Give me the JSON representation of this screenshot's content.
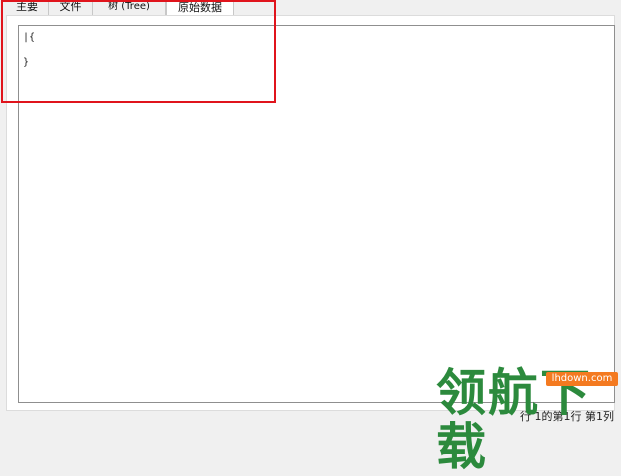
{
  "tabs": [
    {
      "label": "主要"
    },
    {
      "label": "文件"
    },
    {
      "label": "树 (Tree)"
    },
    {
      "label": "原始数据",
      "active": true
    }
  ],
  "editor": {
    "lines": [
      "|{",
      "}"
    ]
  },
  "annotation": {
    "color": "#e0141c"
  },
  "status": {
    "text": "行 1的第1行 第1列"
  },
  "watermark": {
    "logo_text": "领航下载",
    "url": "lhdown.com",
    "color": "#2c8a3d",
    "badge_color": "#f47a20"
  }
}
